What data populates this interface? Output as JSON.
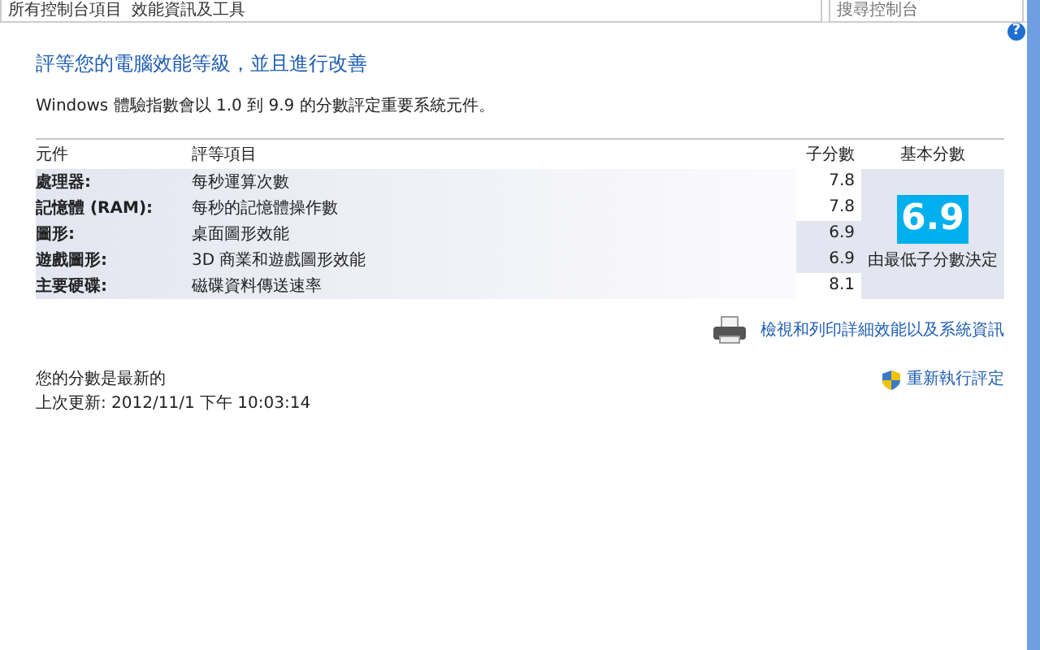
{
  "address_bar": {
    "breadcrumbs": [
      "所有控制台項目",
      "效能資訊及工具"
    ]
  },
  "search": {
    "placeholder": "搜尋控制台"
  },
  "help_button": "?",
  "heading": "評等您的電腦效能等級，並且進行改善",
  "description": "Windows 體驗指數會以 1.0 到 9.9 的分數評定重要系統元件。",
  "table": {
    "columns": [
      "元件",
      "評等項目",
      "子分數",
      "基本分數"
    ],
    "rows": [
      {
        "component": "處理器:",
        "item": "每秒運算次數",
        "subscore": "7.8",
        "lowest": false
      },
      {
        "component": "記憶體 (RAM):",
        "item": "每秒的記憶體操作數",
        "subscore": "7.8",
        "lowest": false
      },
      {
        "component": "圖形:",
        "item": "桌面圖形效能",
        "subscore": "6.9",
        "lowest": true
      },
      {
        "component": "遊戲圖形:",
        "item": "3D 商業和遊戲圖形效能",
        "subscore": "6.9",
        "lowest": true
      },
      {
        "component": "主要硬碟:",
        "item": "磁碟資料傳送速率",
        "subscore": "8.1",
        "lowest": false
      }
    ],
    "base_score": "6.9",
    "base_note": "由最低子分數決定"
  },
  "print_link": "檢視和列印詳細效能以及系統資訊",
  "status": "您的分數是最新的",
  "last_update": "上次更新: 2012/11/1 下午 10:03:14",
  "rerun_link": "重新執行評定"
}
